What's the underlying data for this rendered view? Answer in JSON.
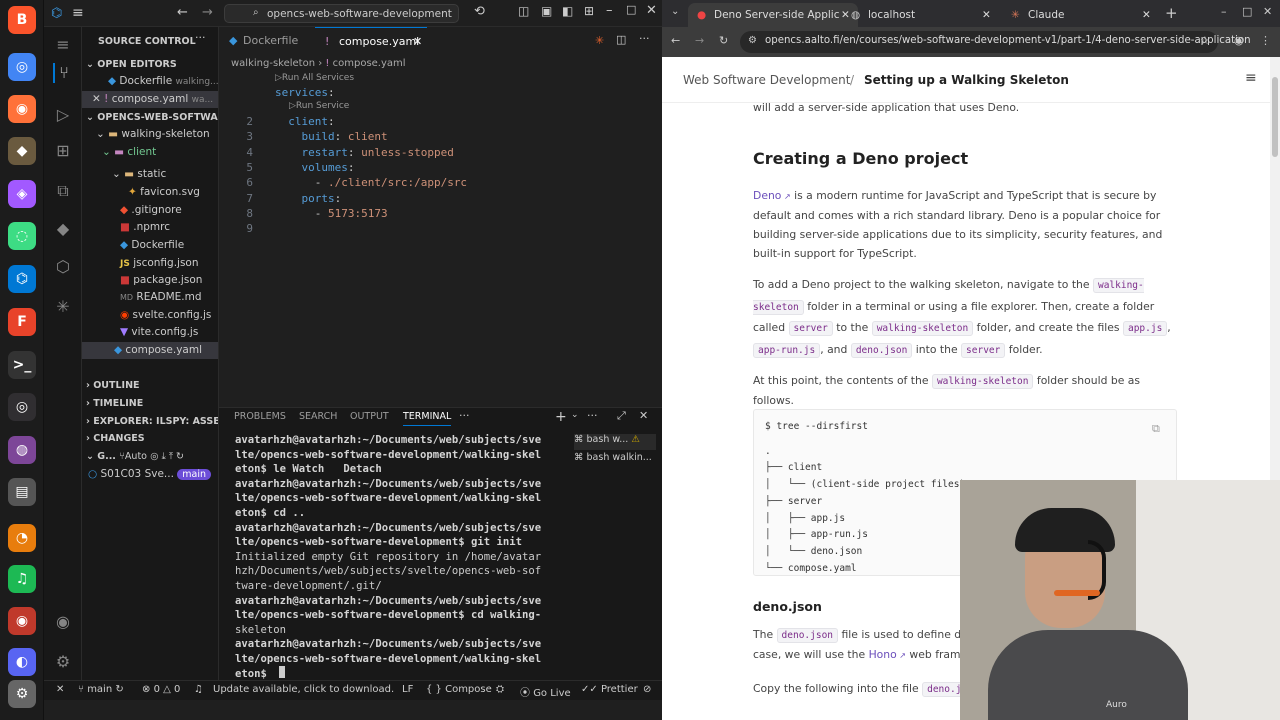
{
  "dock": {
    "icons": [
      "brave-icon",
      "chrome-icon",
      "firefox-icon",
      "gimp-icon",
      "figma-icon",
      "android-studio-icon",
      "vscode-icon",
      "foxit-icon",
      "terminal-icon",
      "obs-icon",
      "tor-icon",
      "files-icon",
      "blender-icon",
      "spotify-icon",
      "eye-icon",
      "discord-icon",
      "settings-icon"
    ]
  },
  "vscode": {
    "search_text": "opencs-web-software-development",
    "explorer_title": "SOURCE CONTROL",
    "open_editors": "OPEN EDITORS",
    "open_editor_items": [
      {
        "name": "Dockerfile",
        "hint": "walking..."
      },
      {
        "name": "compose.yaml",
        "hint": "wa..."
      }
    ],
    "project": "OPENCS-WEB-SOFTWARE...",
    "tree": [
      "walking-skeleton",
      "client",
      "src",
      "static",
      "favicon.svg",
      ".gitignore",
      ".npmrc",
      "Dockerfile",
      "jsconfig.json",
      "package.json",
      "README.md",
      "svelte.config.js",
      "vite.config.js",
      "compose.yaml"
    ],
    "sections": [
      "OUTLINE",
      "TIMELINE",
      "EXPLORER: ILSPY: ASSEM...",
      "CHANGES"
    ],
    "git_label": "G...",
    "auto_label": "Auto",
    "commit_label": "S01C03 Sve...",
    "branch_badge": "main",
    "tabs": [
      {
        "label": "Dockerfile"
      },
      {
        "label": "compose.yaml"
      }
    ],
    "breadcrumb_folder": "walking-skeleton",
    "breadcrumb_file": "compose.yaml",
    "codelens_all": "Run All Services",
    "codelens_one": "Run Service",
    "code": [
      {
        "n": "",
        "t": [
          [
            "k",
            "services"
          ],
          [
            "w",
            ":"
          ]
        ]
      },
      {
        "n": "2",
        "t": [
          [
            "w",
            "  "
          ],
          [
            "k",
            "client"
          ],
          [
            "w",
            ":"
          ]
        ]
      },
      {
        "n": "3",
        "t": [
          [
            "w",
            "    "
          ],
          [
            "k",
            "build"
          ],
          [
            "w",
            ": "
          ],
          [
            "s",
            "client"
          ]
        ]
      },
      {
        "n": "4",
        "t": [
          [
            "w",
            "    "
          ],
          [
            "k",
            "restart"
          ],
          [
            "w",
            ": "
          ],
          [
            "s",
            "unless-stopped"
          ]
        ]
      },
      {
        "n": "5",
        "t": [
          [
            "w",
            "    "
          ],
          [
            "k",
            "volumes"
          ],
          [
            "w",
            ":"
          ]
        ]
      },
      {
        "n": "6",
        "t": [
          [
            "w",
            "      - "
          ],
          [
            "s",
            "./client/src:/app/src"
          ]
        ]
      },
      {
        "n": "7",
        "t": [
          [
            "w",
            "    "
          ],
          [
            "k",
            "ports"
          ],
          [
            "w",
            ":"
          ]
        ]
      },
      {
        "n": "8",
        "t": [
          [
            "w",
            "      - "
          ],
          [
            "s",
            "5173:5173"
          ]
        ]
      },
      {
        "n": "9",
        "t": [
          [
            "w",
            ""
          ]
        ]
      }
    ],
    "panel_tabs": [
      "PROBLEMS",
      "SEARCH",
      "OUTPUT",
      "TERMINAL"
    ],
    "term_lines": [
      "avatarhzh@avatarhzh:~/Documents/web/subjects/sve",
      "lte/opencs-web-software-development/walking-skel",
      "eton$ le Watch   Detach",
      "avatarhzh@avatarhzh:~/Documents/web/subjects/sve",
      "lte/opencs-web-software-development/walking-skel",
      "eton$ cd ..",
      "avatarhzh@avatarhzh:~/Documents/web/subjects/sve",
      "lte/opencs-web-software-development$ git init",
      "Initialized empty Git repository in /home/avatar",
      "hzh/Documents/web/subjects/svelte/opencs-web-sof",
      "tware-development/.git/",
      "avatarhzh@avatarhzh:~/Documents/web/subjects/sve",
      "lte/opencs-web-software-development$ cd walking-",
      "skeleton",
      "avatarhzh@avatarhzh:~/Documents/web/subjects/sve",
      "lte/opencs-web-software-development/walking-skel",
      "eton$ "
    ],
    "term_list": [
      "bash w...",
      "bash walkin..."
    ],
    "status": {
      "branch": "main",
      "errors": "0",
      "warnings": "0",
      "update": "Update available, click to download.",
      "eol": "LF",
      "lang": "Compose",
      "golive": "Go Live",
      "prettier": "Prettier"
    }
  },
  "browser": {
    "tabs": [
      {
        "label": "Deno Server-side Applic"
      },
      {
        "label": "localhost"
      },
      {
        "label": "Claude"
      }
    ],
    "url": "opencs.aalto.fi/en/courses/web-software-development-v1/part-1/4-deno-server-side-application",
    "course": "Web Software Development",
    "page_title": "Setting up a Walking Skeleton",
    "intro_tail": "will add a server-side application that uses Deno.",
    "h2": "Creating a Deno project",
    "p1_link": "Deno",
    "p1": " is a modern runtime for JavaScript and TypeScript that is secure by default and comes with a rich standard library. Deno is a popular choice for building server-side applications due to its simplicity, security features, and built-in support for TypeScript.",
    "p2": {
      "a": "To add a Deno project to the walking skeleton, navigate to the",
      "c1": "walking-skeleton",
      "b": "folder in a terminal or using a file explorer. Then, create a folder called",
      "c2": "server",
      "c": "to the",
      "c3": "walking-skeleton",
      "d": "folder, and create the files",
      "c4": "app.js",
      "e": ",",
      "c5": "app-run.js",
      "f": ", and",
      "c6": "deno.json",
      "g": "into the",
      "c7": "server",
      "h": "folder."
    },
    "p3": {
      "a": "At this point, the contents of the",
      "c1": "walking-skeleton",
      "b": "folder should be as follows."
    },
    "tree_lines": [
      "$ tree --dirsfirst",
      ".",
      "├── client",
      "│   └── (client-side project files)",
      "├── server",
      "│   ├── app.js",
      "│   ├── app-run.js",
      "│   └── deno.json",
      "└── compose.yaml"
    ],
    "h3": "deno.json",
    "p4": {
      "a": "The",
      "c1": "deno.json",
      "b": "file is used to define dep",
      "c": "case, we will use the",
      "link": "Hono",
      "d": " web framew"
    },
    "p5": {
      "a": "Copy the following into the file",
      "c1": "deno.json"
    }
  },
  "webcam": {
    "shirt_text": "Auro"
  }
}
